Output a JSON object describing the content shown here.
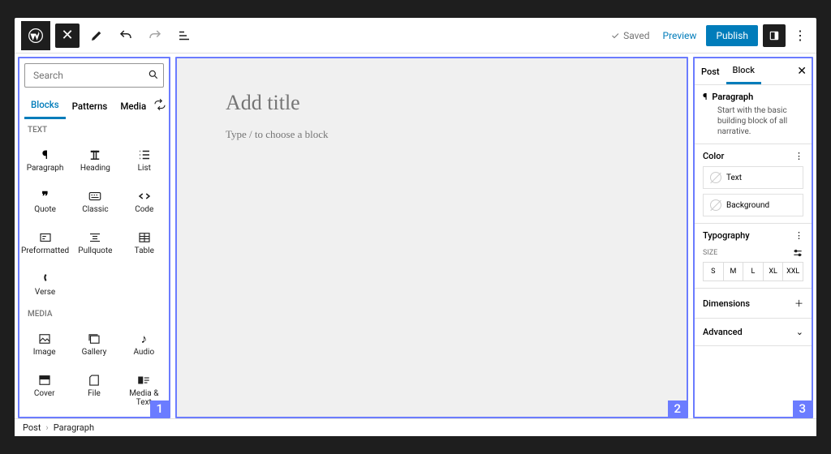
{
  "toolbar": {
    "saved": "Saved",
    "preview": "Preview",
    "publish": "Publish"
  },
  "inserter": {
    "search_placeholder": "Search",
    "tabs": {
      "blocks": "Blocks",
      "patterns": "Patterns",
      "media": "Media"
    },
    "cat_text": "TEXT",
    "cat_media": "MEDIA",
    "blocks_text": [
      {
        "label": "Paragraph"
      },
      {
        "label": "Heading"
      },
      {
        "label": "List"
      },
      {
        "label": "Quote"
      },
      {
        "label": "Classic"
      },
      {
        "label": "Code"
      },
      {
        "label": "Preformatted"
      },
      {
        "label": "Pullquote"
      },
      {
        "label": "Table"
      },
      {
        "label": "Verse"
      }
    ],
    "blocks_media": [
      {
        "label": "Image"
      },
      {
        "label": "Gallery"
      },
      {
        "label": "Audio"
      },
      {
        "label": "Cover"
      },
      {
        "label": "File"
      },
      {
        "label": "Media & Text"
      }
    ]
  },
  "canvas": {
    "title_placeholder": "Add title",
    "paragraph_hint": "Type / to choose a block"
  },
  "settings": {
    "tab_post": "Post",
    "tab_block": "Block",
    "block_name": "Paragraph",
    "block_desc": "Start with the basic building block of all narrative.",
    "color_heading": "Color",
    "color_text": "Text",
    "color_background": "Background",
    "typo_heading": "Typography",
    "size_label": "SIZE",
    "sizes": [
      "S",
      "M",
      "L",
      "XL",
      "XXL"
    ],
    "dimensions": "Dimensions",
    "advanced": "Advanced"
  },
  "breadcrumb": {
    "post": "Post",
    "leaf": "Paragraph"
  },
  "labels": {
    "p1": "1",
    "p2": "2",
    "p3": "3"
  }
}
